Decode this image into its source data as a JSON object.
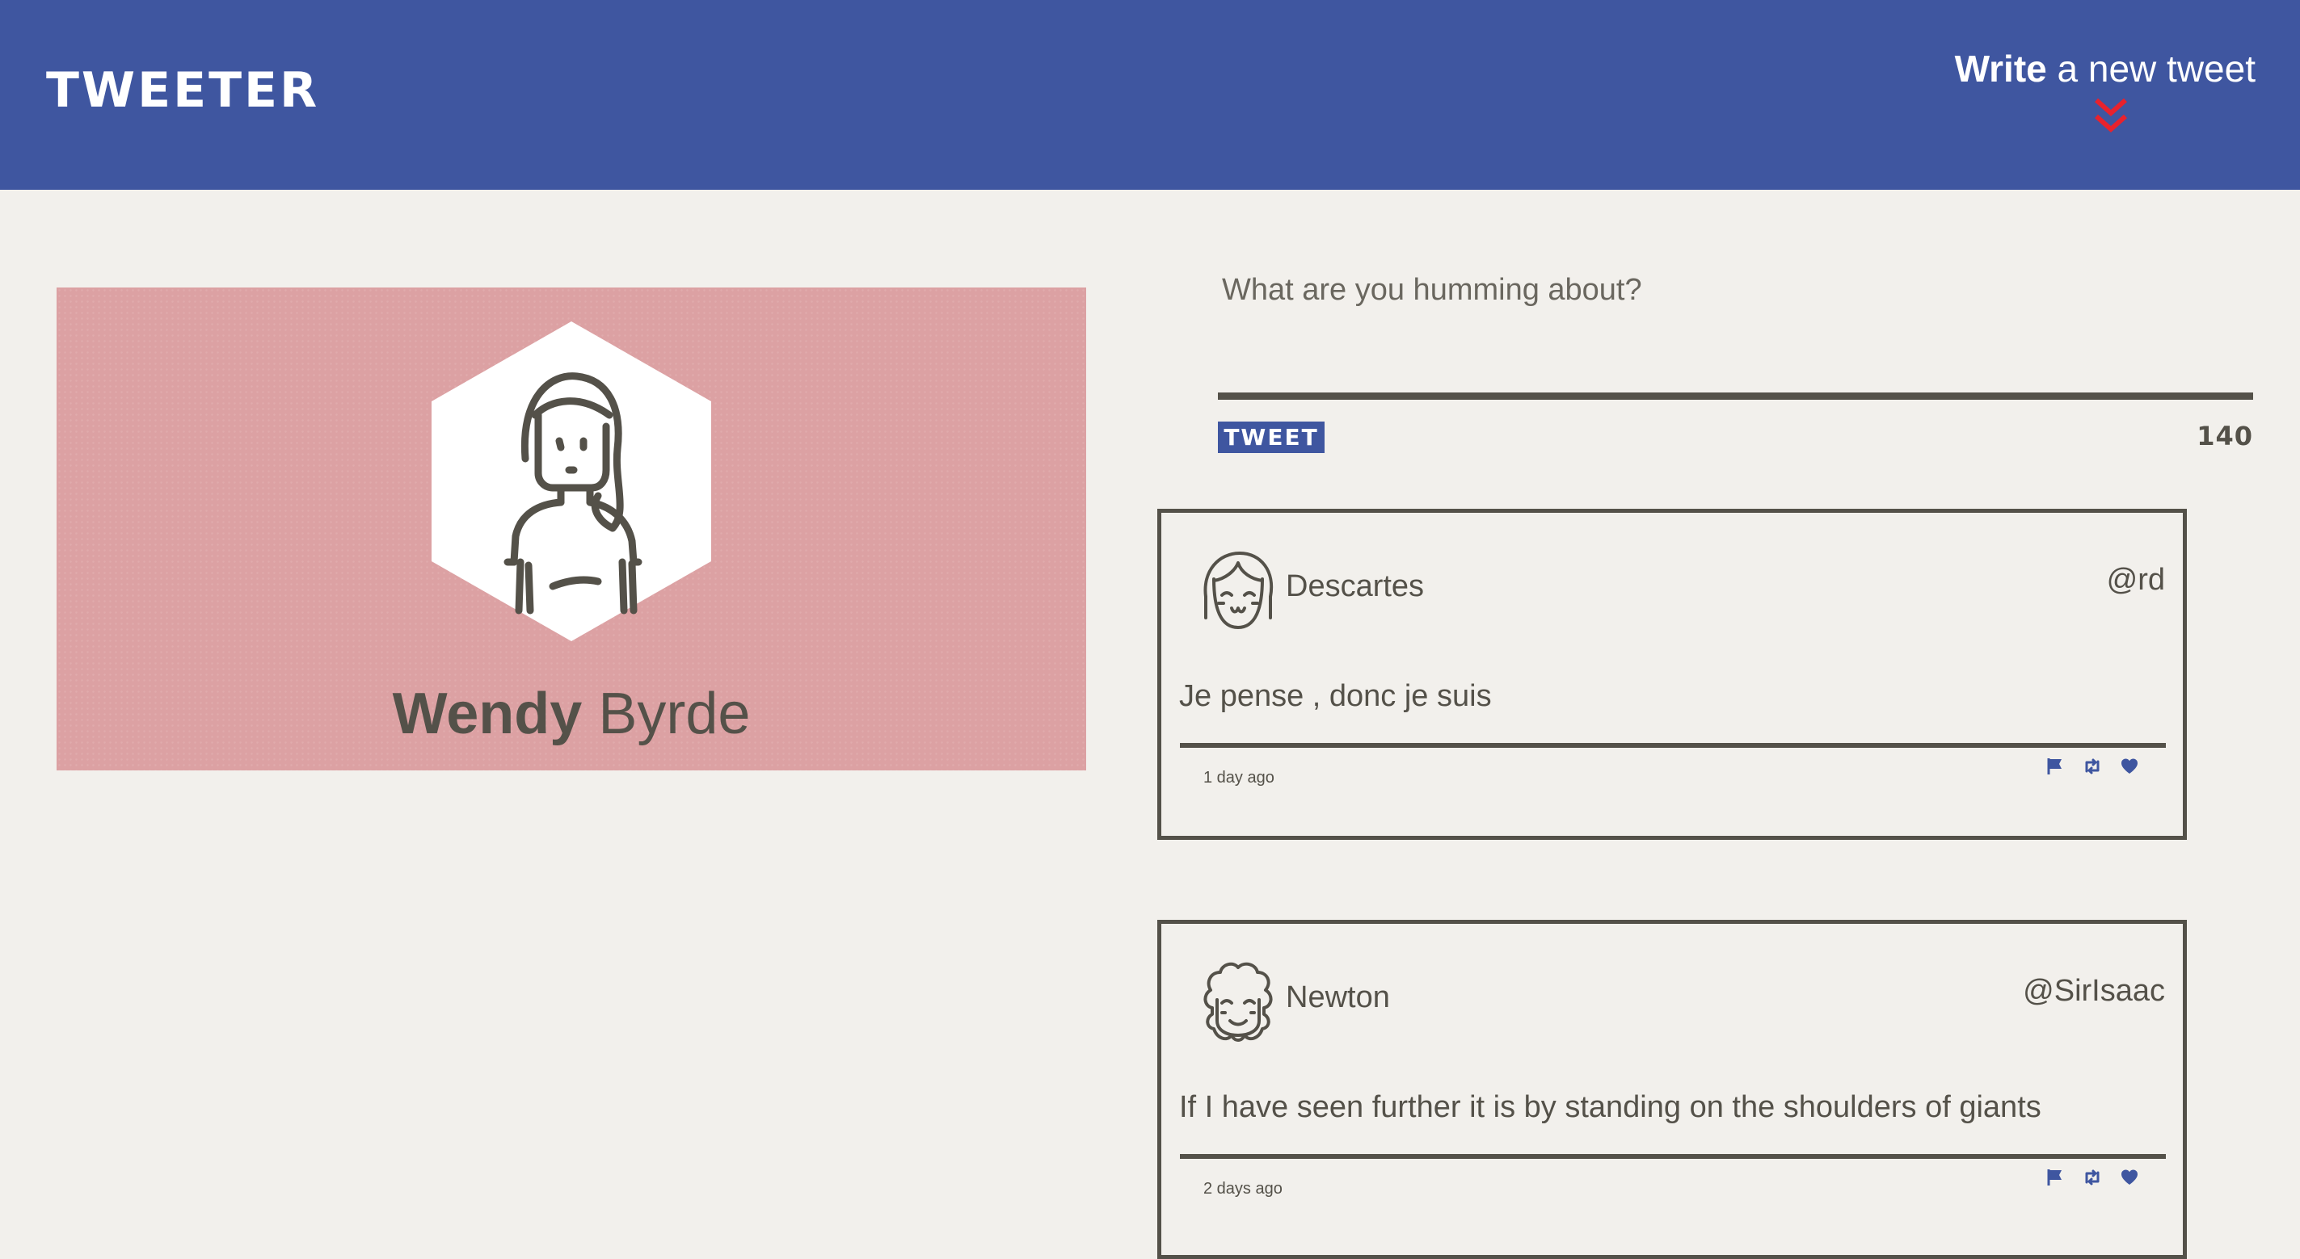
{
  "nav": {
    "brand": "TWEETER",
    "compose_strong": "Write",
    "compose_rest": "a new tweet",
    "compose_icon": "double-chevron-down-icon",
    "compose_icon_color": "#e8222d"
  },
  "colors": {
    "nav_bg": "#3f56a0",
    "page_bg": "#f2f0ec",
    "profile_bg": "#dca1a3",
    "text": "#545149"
  },
  "profile": {
    "first_name": "Wendy",
    "last_name": "Byrde",
    "avatar_icon": "woman-avatar-icon"
  },
  "composer": {
    "placeholder": "What are you humming about?",
    "value": "",
    "button_label": "TWEET",
    "counter": "140"
  },
  "tweets": [
    {
      "name": "Descartes",
      "handle": "@rd",
      "text": "Je pense , donc je suis",
      "time": "1 day ago",
      "avatar_icon": "smiling-person-avatar-icon",
      "actions": [
        "flag-icon",
        "retweet-icon",
        "heart-icon"
      ]
    },
    {
      "name": "Newton",
      "handle": "@SirIsaac",
      "text": "If I have seen further it is by standing on the shoulders of giants",
      "time": "2 days ago",
      "avatar_icon": "curly-hair-avatar-icon",
      "actions": [
        "flag-icon",
        "retweet-icon",
        "heart-icon"
      ]
    }
  ]
}
